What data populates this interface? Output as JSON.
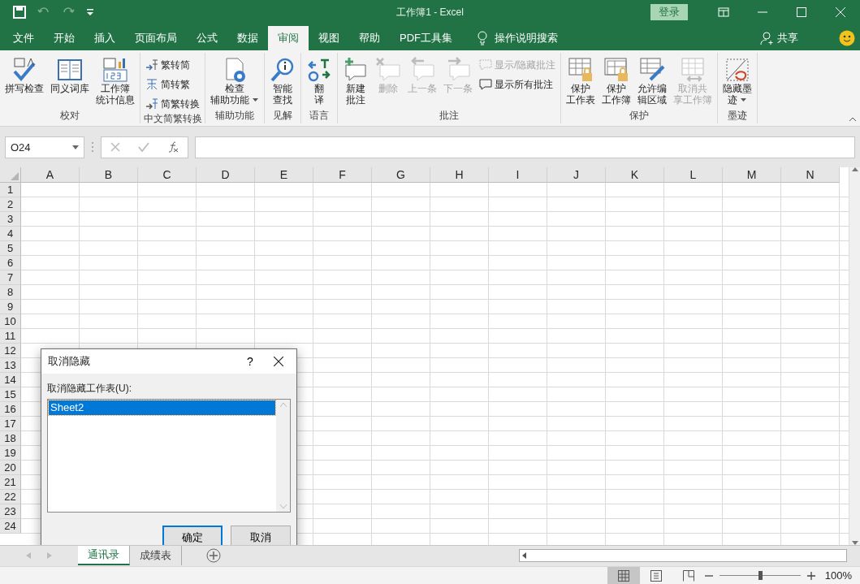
{
  "title_bar": {
    "title": "工作簿1  -  Excel",
    "sign_in": "登录"
  },
  "ribbon_tabs": [
    {
      "label": "文件",
      "selected": false
    },
    {
      "label": "开始",
      "selected": false
    },
    {
      "label": "插入",
      "selected": false
    },
    {
      "label": "页面布局",
      "selected": false
    },
    {
      "label": "公式",
      "selected": false
    },
    {
      "label": "数据",
      "selected": false
    },
    {
      "label": "审阅",
      "selected": true
    },
    {
      "label": "视图",
      "selected": false
    },
    {
      "label": "帮助",
      "selected": false
    },
    {
      "label": "PDF工具集",
      "selected": false
    }
  ],
  "tell_me": "操作说明搜索",
  "share": "共享",
  "ribbon_groups": [
    {
      "label": "校对",
      "items": [
        {
          "kind": "large",
          "label": [
            "拼写检查"
          ],
          "disabled": false
        },
        {
          "kind": "large",
          "label": [
            "同义词库"
          ],
          "disabled": false
        },
        {
          "kind": "large",
          "label": [
            "工作簿",
            "统计信息"
          ],
          "disabled": false
        }
      ]
    },
    {
      "label": "中文简繁转换",
      "items": [
        {
          "kind": "small",
          "label": "繁转简",
          "disabled": false
        },
        {
          "kind": "small",
          "label": "简转繁",
          "disabled": false
        },
        {
          "kind": "small",
          "label": "简繁转换",
          "disabled": false
        }
      ]
    },
    {
      "label": "辅助功能",
      "items": [
        {
          "kind": "large",
          "label": [
            "检查",
            "辅助功能"
          ],
          "disabled": false,
          "dropdown": true
        }
      ]
    },
    {
      "label": "见解",
      "items": [
        {
          "kind": "large",
          "label": [
            "智能",
            "查找"
          ],
          "disabled": false
        }
      ]
    },
    {
      "label": "语言",
      "items": [
        {
          "kind": "large",
          "label": [
            "翻",
            "译"
          ],
          "disabled": false
        }
      ]
    },
    {
      "label": "批注",
      "items": [
        {
          "kind": "large",
          "label": [
            "新建",
            "批注"
          ],
          "disabled": false
        },
        {
          "kind": "large",
          "label": [
            "删除"
          ],
          "disabled": true
        },
        {
          "kind": "large",
          "label": [
            "上一条"
          ],
          "disabled": true
        },
        {
          "kind": "large",
          "label": [
            "下一条"
          ],
          "disabled": true
        },
        {
          "kind": "small",
          "label": "显示/隐藏批注",
          "disabled": true
        },
        {
          "kind": "small",
          "label": "显示所有批注",
          "disabled": false
        }
      ]
    },
    {
      "label": "保护",
      "items": [
        {
          "kind": "large",
          "label": [
            "保护",
            "工作表"
          ],
          "disabled": false
        },
        {
          "kind": "large",
          "label": [
            "保护",
            "工作簿"
          ],
          "disabled": false
        },
        {
          "kind": "large",
          "label": [
            "允许编",
            "辑区域"
          ],
          "disabled": false
        },
        {
          "kind": "large",
          "label": [
            "取消共",
            "享工作簿"
          ],
          "disabled": true
        }
      ]
    },
    {
      "label": "墨迹",
      "items": [
        {
          "kind": "large",
          "label": [
            "隐藏墨",
            "迹"
          ],
          "disabled": false,
          "dropdown": true
        }
      ]
    }
  ],
  "name_box": "O24",
  "columns": [
    "A",
    "B",
    "C",
    "D",
    "E",
    "F",
    "G",
    "H",
    "I",
    "J",
    "K",
    "L",
    "M",
    "N"
  ],
  "rows": [
    "1",
    "2",
    "3",
    "4",
    "5",
    "6",
    "7",
    "8",
    "9",
    "10",
    "11",
    "12",
    "13",
    "14",
    "15",
    "16",
    "17",
    "18",
    "19",
    "20",
    "21",
    "22",
    "23",
    "24"
  ],
  "dialog": {
    "title": "取消隐藏",
    "help": "?",
    "list_label": "取消隐藏工作表(U):",
    "sheets": [
      {
        "name": "Sheet2",
        "selected": true
      }
    ],
    "buttons": [
      {
        "label": "确定",
        "default": true
      },
      {
        "label": "取消",
        "default": false
      }
    ]
  },
  "sheet_tabs": [
    {
      "label": "通讯录",
      "selected": true
    },
    {
      "label": "成绩表",
      "selected": false
    }
  ],
  "status_bar": {
    "views": [
      {
        "selected": true
      },
      {
        "selected": false
      },
      {
        "selected": false
      }
    ],
    "level": 0.5,
    "zoom": "100%"
  }
}
